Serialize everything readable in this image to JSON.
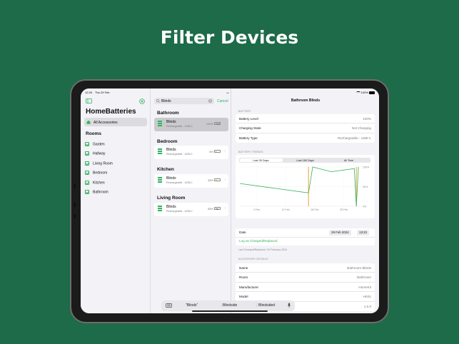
{
  "headline": "Filter Devices",
  "status_bar": {
    "time": "12:25",
    "date": "Thu 29 Feb",
    "battery": "100%"
  },
  "sidebar": {
    "title": "HomeBatteries",
    "all_accessories": "All Accessories",
    "rooms_heading": "Rooms",
    "rooms": [
      "Garden",
      "Hallway",
      "Living Room",
      "Bedroom",
      "Kitchen",
      "Bathroom"
    ]
  },
  "search": {
    "value": "Blinds",
    "cancel": "Cancel"
  },
  "device_groups": [
    {
      "room": "Bathroom",
      "device": "Blinds",
      "type": "Rechargeable - USB-C",
      "level": "100%",
      "fraction": 1.0,
      "color": "#8e8e93",
      "selected": true
    },
    {
      "room": "Bedroom",
      "device": "Blinds",
      "type": "Rechargeable - USB-C",
      "level": "8%",
      "fraction": 0.08,
      "color": "#ff3b30",
      "selected": false
    },
    {
      "room": "Kitchen",
      "device": "Blinds",
      "type": "Rechargeable - USB-C",
      "level": "38%",
      "fraction": 0.38,
      "color": "#ffcc00",
      "selected": false
    },
    {
      "room": "Living Room",
      "device": "Blinds",
      "type": "Rechargeable - USB-C",
      "level": "58%",
      "fraction": 0.58,
      "color": "#8e8e93",
      "selected": false
    }
  ],
  "detail": {
    "title": "Bathroom Blinds",
    "battery_section": "Battery",
    "battery_rows": [
      {
        "label": "Battery Level",
        "value": "100%"
      },
      {
        "label": "Charging State",
        "value": "Not Charging"
      },
      {
        "label": "Battery Type",
        "value": "Rechargeable - USB-C"
      }
    ],
    "trends_section": "Battery Trends",
    "trend_tabs": [
      "Last 30 Days",
      "Last 180 Days",
      "All Time"
    ],
    "date_label": "Date",
    "date_value": "29 Feb 2024",
    "time_value": "13:23",
    "log_action": "Log as Charged/Replaced",
    "last_charged": "Last Charged/Replaced: 29 February 2024",
    "accessory_section": "Accessory Details",
    "accessory_rows": [
      {
        "label": "Name",
        "value": "Bathroom Blinds"
      },
      {
        "label": "Room",
        "value": "Bathroom"
      },
      {
        "label": "Manufacturer",
        "value": "HomeKit"
      },
      {
        "label": "Model",
        "value": "HK01"
      },
      {
        "label": "",
        "value": "1.0.0"
      }
    ]
  },
  "chart_data": {
    "type": "line",
    "x_ticks": [
      "4 Feb",
      "11 Feb",
      "18 Feb",
      "25 Feb"
    ],
    "y_ticks": [
      "100%",
      "50%",
      "0%"
    ],
    "ylim": [
      0,
      100
    ],
    "points": [
      [
        0,
        58
      ],
      [
        16.5,
        34
      ],
      [
        17.5,
        100
      ],
      [
        22,
        88
      ],
      [
        27.5,
        96
      ],
      [
        28,
        0
      ],
      [
        28.5,
        100
      ]
    ],
    "charged_markers": [
      16.5,
      28
    ]
  },
  "keyboard_suggestions": [
    "\"Blinds\"",
    "Blindside",
    "Blindsided"
  ],
  "colors": {
    "accent": "#30b35a",
    "background": "#1d6b48"
  }
}
